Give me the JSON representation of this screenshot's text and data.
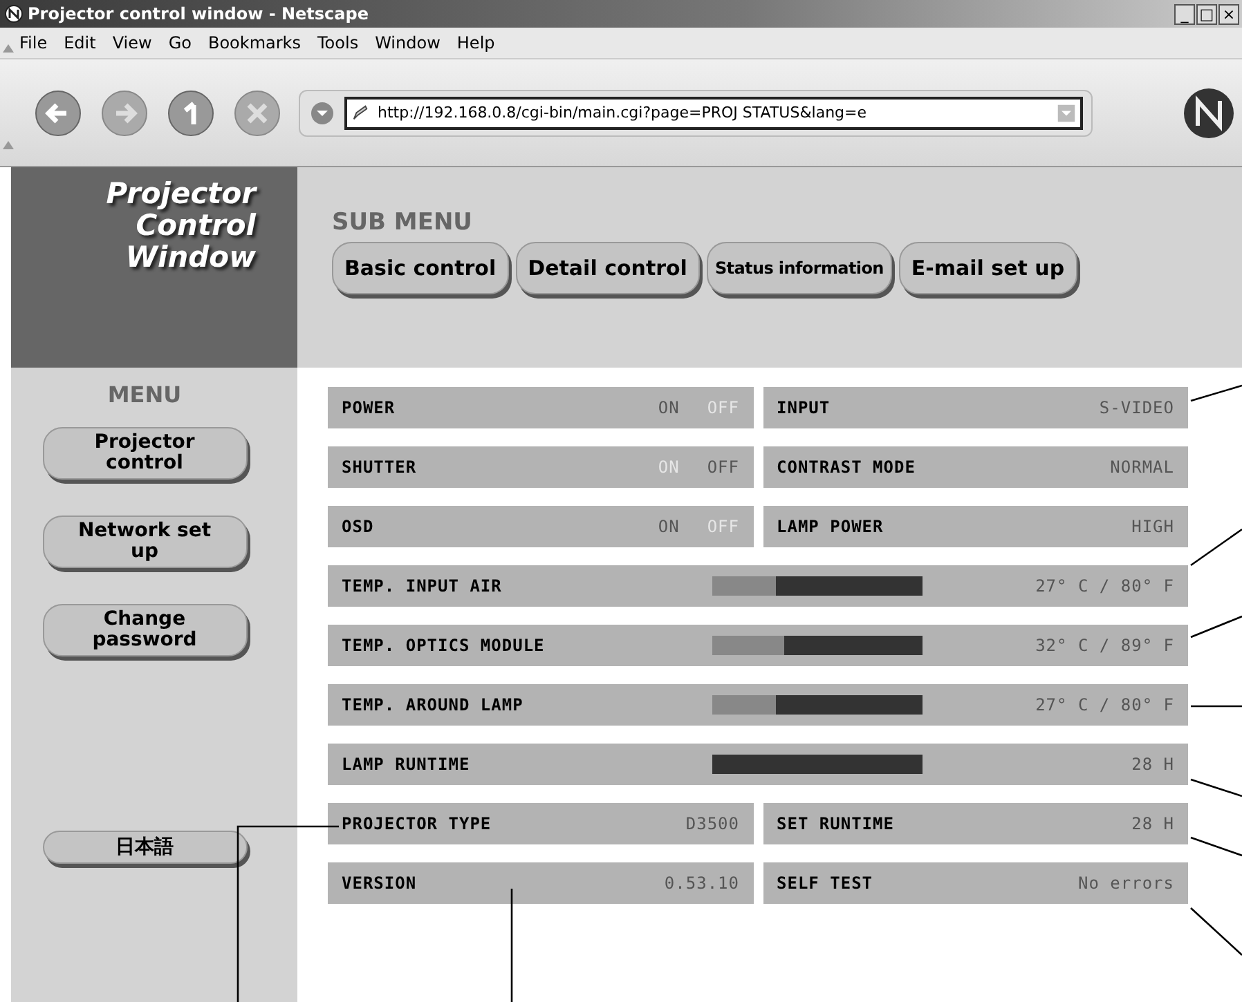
{
  "window": {
    "title": "Projector control window - Netscape",
    "controls": [
      "_",
      "□",
      "×"
    ]
  },
  "menu_bar": [
    "File",
    "Edit",
    "View",
    "Go",
    "Bookmarks",
    "Tools",
    "Window",
    "Help"
  ],
  "toolbar": {
    "address": "http://192.168.0.8/cgi-bin/main.cgi?page=PROJ STATUS&lang=e"
  },
  "logo": [
    "Projector",
    "Control",
    "Window"
  ],
  "sub_menu": {
    "title": "SUB MENU",
    "buttons": [
      "Basic control",
      "Detail control",
      "Status information",
      "E-mail set up"
    ]
  },
  "menu": {
    "title": "MENU",
    "buttons": [
      "Projector control",
      "Network set up",
      "Change password",
      "日本語"
    ]
  },
  "status": [
    {
      "kind": "pair",
      "cells": [
        {
          "kind": "onoff",
          "label": "POWER",
          "on_label": "ON",
          "off_label": "OFF",
          "on": true
        },
        {
          "kind": "value",
          "label": "INPUT",
          "value": "S-VIDEO"
        }
      ]
    },
    {
      "kind": "pair",
      "cells": [
        {
          "kind": "onoff",
          "label": "SHUTTER",
          "on_label": "ON",
          "off_label": "OFF",
          "on": false
        },
        {
          "kind": "value",
          "label": "CONTRAST MODE",
          "value": "NORMAL"
        }
      ]
    },
    {
      "kind": "pair",
      "cells": [
        {
          "kind": "onoff",
          "label": "OSD",
          "on_label": "ON",
          "off_label": "OFF",
          "on": true
        },
        {
          "kind": "value",
          "label": "LAMP POWER",
          "value": "HIGH"
        }
      ]
    },
    {
      "kind": "bar",
      "label": "TEMP. INPUT AIR",
      "level": 0.3,
      "reading": "27° C / 80° F"
    },
    {
      "kind": "bar",
      "label": "TEMP. OPTICS MODULE",
      "level": 0.34,
      "reading": "32° C / 89° F"
    },
    {
      "kind": "bar",
      "label": "TEMP. AROUND LAMP",
      "level": 0.3,
      "reading": "27° C / 80° F"
    },
    {
      "kind": "bar",
      "label": "LAMP RUNTIME",
      "level": 0,
      "reading": "28 H"
    },
    {
      "kind": "pair",
      "cells": [
        {
          "kind": "value",
          "label": "PROJECTOR TYPE",
          "value": "D3500"
        },
        {
          "kind": "value",
          "label": "SET RUNTIME",
          "value": "28 H"
        }
      ]
    },
    {
      "kind": "pair",
      "cells": [
        {
          "kind": "value",
          "label": "VERSION",
          "value": "0.53.10"
        },
        {
          "kind": "value",
          "label": "SELF TEST",
          "value": "No errors"
        }
      ]
    }
  ]
}
